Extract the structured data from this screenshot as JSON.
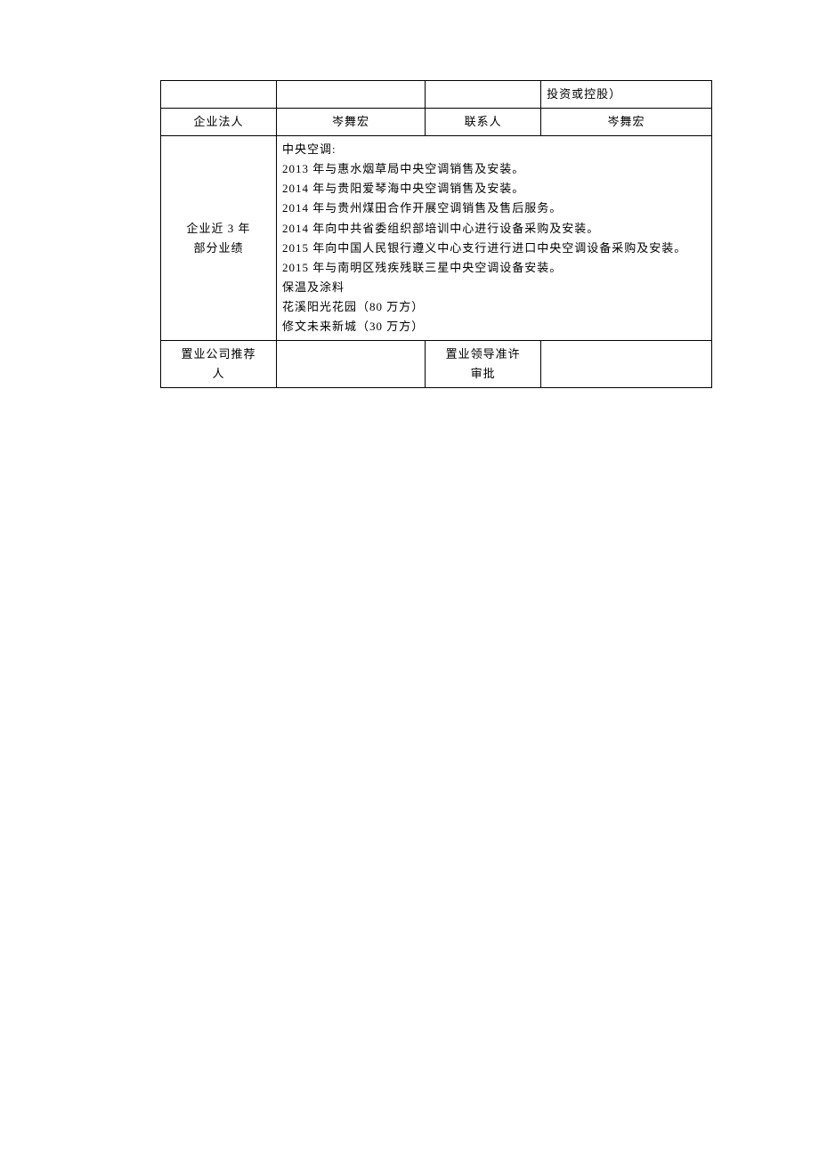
{
  "row_top": {
    "col4": "投资或控股）"
  },
  "row_legal": {
    "label": "企业法人",
    "value": "岑舞宏",
    "contact_label": "联系人",
    "contact_value": "岑舞宏"
  },
  "row_achievements": {
    "label_line1": "企业近 3 年",
    "label_line2": "部分业绩",
    "lines": [
      "中央空调:",
      "2013 年与惠水烟草局中央空调销售及安装。",
      "2014 年与贵阳爱琴海中央空调销售及安装。",
      "2014 年与贵州煤田合作开展空调销售及售后服务。",
      "2014 年向中共省委组织部培训中心进行设备采购及安装。",
      "2015 年向中国人民银行遵义中心支行进行进口中央空调设备采购及安装。",
      "2015 年与南明区残疾残联三星中央空调设备安装。",
      "保温及涂料",
      "花溪阳光花园（80 万方）",
      "修文未来新城（30 万方）"
    ]
  },
  "row_recommender": {
    "label_line1": "置业公司推荐",
    "label_line2": "人",
    "value": "",
    "approve_label_line1": "置业领导准许",
    "approve_label_line2": "审批",
    "approve_value": ""
  }
}
